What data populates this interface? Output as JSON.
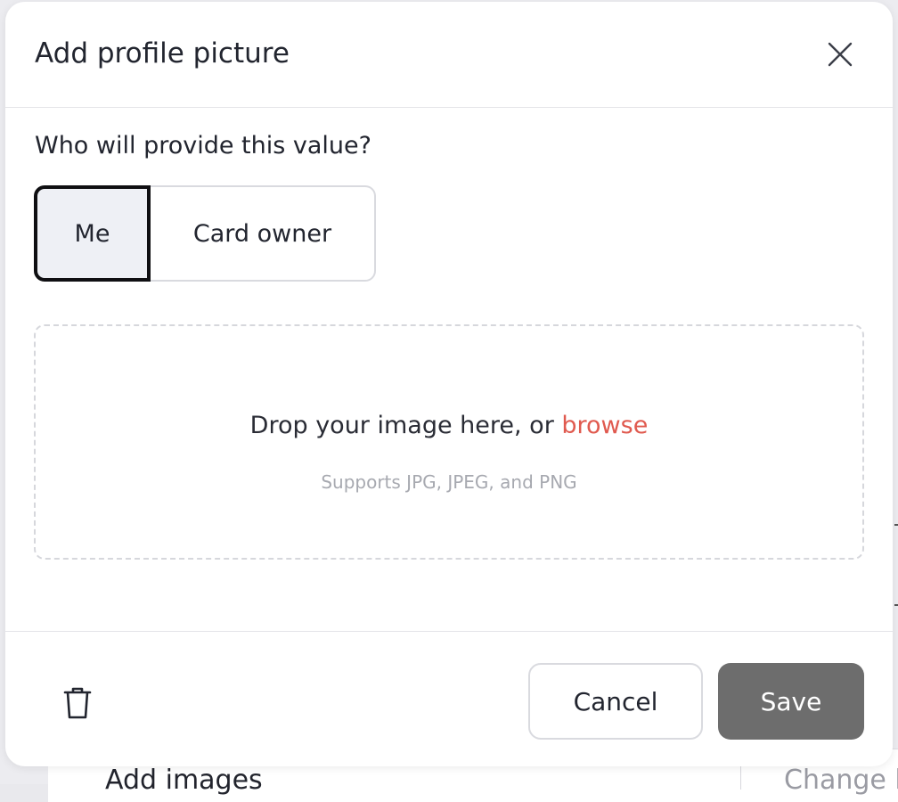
{
  "modal": {
    "title": "Add profile picture",
    "close_icon": "close-icon"
  },
  "provider": {
    "question": "Who will provide this value?",
    "options": [
      {
        "label": "Me",
        "selected": true
      },
      {
        "label": "Card owner",
        "selected": false
      }
    ]
  },
  "upload": {
    "prompt": "Drop your image here, or",
    "browse_label": "browse",
    "supported_formats": "Supports JPG, JPEG, and PNG"
  },
  "footer": {
    "delete_icon": "trash-icon",
    "cancel_label": "Cancel",
    "save_label": "Save"
  },
  "background": {
    "left_text": "Add images",
    "right_text": "Change l"
  },
  "colors": {
    "accent_link": "#e05a4f",
    "save_button": "#6d6d6d",
    "selected_segment_bg": "#eef0f5"
  }
}
